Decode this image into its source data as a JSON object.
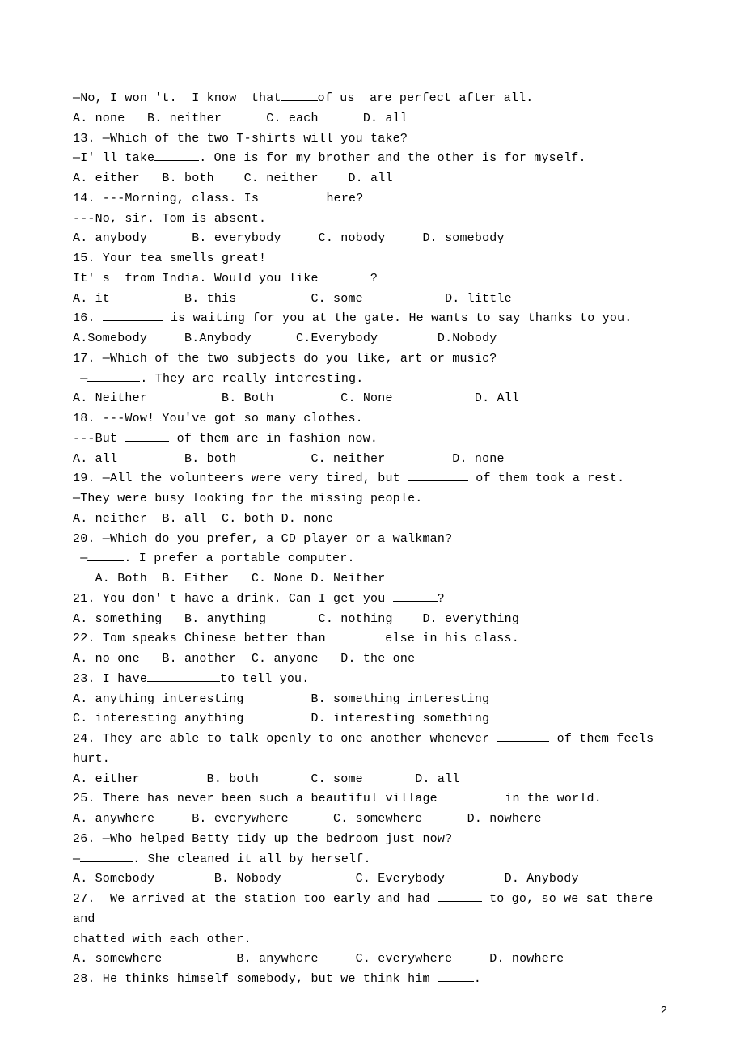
{
  "lines": {
    "l12a": "—No, I won 't.  I know  that",
    "l12b": "of us  are perfect after all.",
    "l12c": "A. none   B. neither      C. each      D. all",
    "l13a": "13. —Which of the two T-shirts will you take?",
    "l13b": "—I' ll take",
    "l13c": ". One is for my brother and the other is for myself.",
    "l13d": "A. either   B. both    C. neither    D. all",
    "l14a": "14. ---Morning, class. Is ",
    "l14b": " here?",
    "l14c": "---No, sir. Tom is absent.",
    "l14d": "A. anybody      B. everybody     C. nobody     D. somebody",
    "l15a": "15. Your tea smells great!",
    "l15b": "It' s  from India. Would you like ",
    "l15c": "?",
    "l15d": "A. it          B. this          C. some           D. little",
    "l16a": "16. ",
    "l16b": " is waiting for you at the gate. He wants to say thanks to you.",
    "l16c": "A.Somebody     B.Anybody      C.Everybody        D.Nobody",
    "l17a": "17. —Which of the two subjects do you like, art or music?",
    "l17b": " —",
    "l17c": ". They are really interesting.",
    "l17d": "A. Neither          B. Both         C. None           D. All",
    "l18a": "18. ---Wow! You've got so many clothes.",
    "l18b": "---But ",
    "l18c": " of them are in fashion now.",
    "l18d": "A. all         B. both          C. neither         D. none",
    "l19a": "19. —All the volunteers were very tired, but ",
    "l19b": " of them took a rest.",
    "l19c": "—They were busy looking for the missing people.",
    "l19d": "A. neither  B. all  C. both D. none",
    "l20a": "20. —Which do you prefer, a CD player or a walkman?",
    "l20b": " —",
    "l20c": ". I prefer a portable computer.",
    "l20d": "   A. Both  B. Either   C. None D. Neither",
    "l21a": "21. You don' t have a drink. Can I get you ",
    "l21b": "?",
    "l21c": "A. something   B. anything       C. nothing    D. everything",
    "l22a": "22. Tom speaks Chinese better than ",
    "l22b": " else in his class.",
    "l22c": "A. no one   B. another  C. anyone   D. the one",
    "l23a": "23. I have",
    "l23b": "to tell you.",
    "l23c": "A. anything interesting         B. something interesting",
    "l23d": "C. interesting anything         D. interesting something",
    "l24a": "24. They are able to talk openly to one another whenever ",
    "l24b": " of them feels",
    "l24c": "hurt.",
    "l24d": "A. either         B. both       C. some       D. all",
    "l25a": "25. There has never been such a beautiful village ",
    "l25b": " in the world.",
    "l25c": "A. anywhere     B. everywhere      C. somewhere      D. nowhere",
    "l26a": "26. —Who helped Betty tidy up the bedroom just now?",
    "l26b": "—",
    "l26c": ". She cleaned it all by herself.",
    "l26d": "A. Somebody        B. Nobody          C. Everybody        D. Anybody",
    "l27a": "27.  We arrived at the station too early and had ",
    "l27b": " to go, so we sat there and",
    "l27c": "chatted with each other.",
    "l27d": "A. somewhere          B. anywhere     C. everywhere     D. nowhere",
    "l28a": "28. He thinks himself somebody, but we think him ",
    "l28b": "."
  },
  "page_number": "2"
}
